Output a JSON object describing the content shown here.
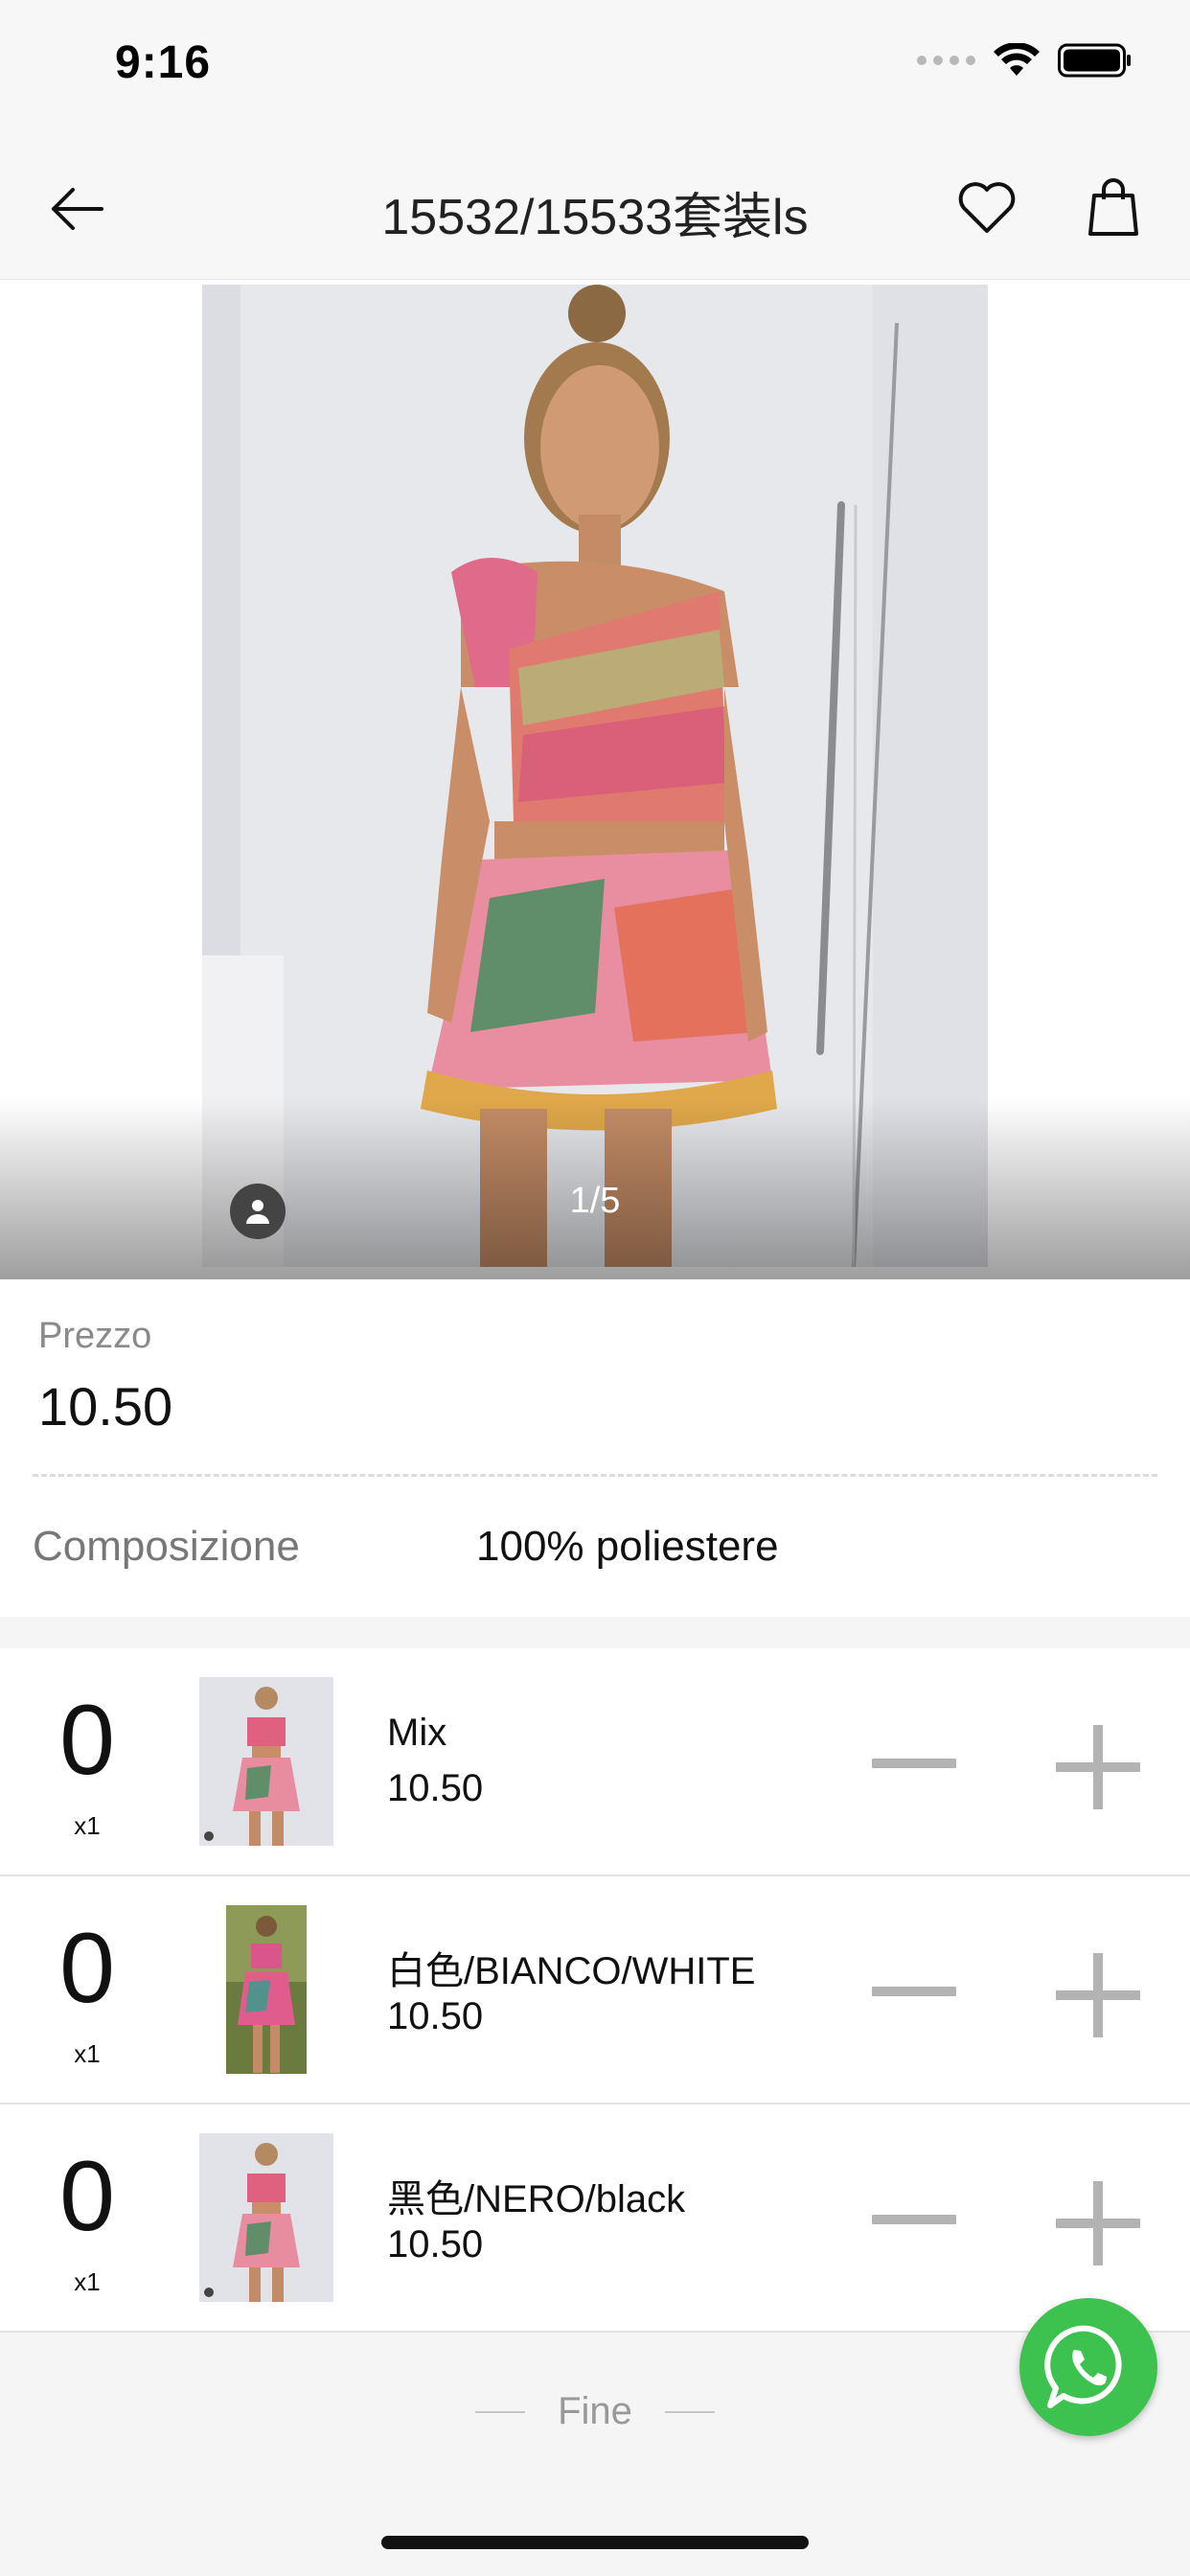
{
  "status_bar": {
    "time": "9:16"
  },
  "nav": {
    "title": "15532/15533套装ls"
  },
  "gallery": {
    "counter": "1/5"
  },
  "product": {
    "price_label": "Prezzo",
    "price": "10.50",
    "composition_label": "Composizione",
    "composition_value": "100% poliestere"
  },
  "variants": [
    {
      "qty": "0",
      "multiplier": "x1",
      "name": "Mix",
      "price": "10.50"
    },
    {
      "qty": "0",
      "multiplier": "x1",
      "name": "白色/BIANCO/WHITE",
      "price": "10.50"
    },
    {
      "qty": "0",
      "multiplier": "x1",
      "name": "黑色/NERO/black",
      "price": "10.50"
    }
  ],
  "footer": {
    "end_label": "Fine"
  },
  "colors": {
    "whatsapp": "#3ec24f",
    "stepper": "#b3b3b3"
  },
  "icons": [
    "back-arrow-icon",
    "heart-icon",
    "shopping-bag-icon",
    "user-icon",
    "minus-icon",
    "plus-icon",
    "whatsapp-icon"
  ]
}
